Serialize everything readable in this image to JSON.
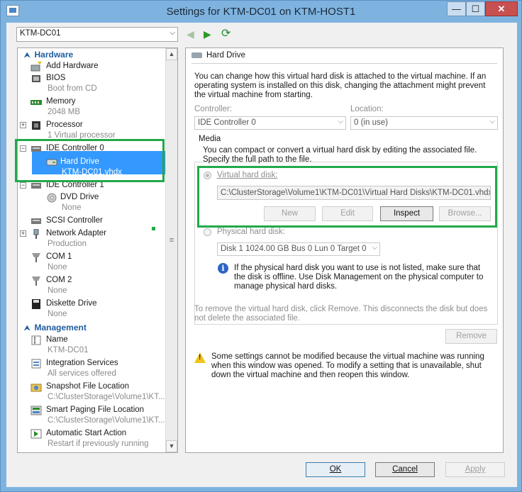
{
  "window": {
    "title": "Settings for KTM-DC01 on KTM-HOST1",
    "min_glyph": "—",
    "max_glyph": "☐",
    "close_glyph": "✕"
  },
  "vm_selector": {
    "value": "KTM-DC01",
    "arrow": "⌵"
  },
  "toolbar": {
    "back_glyph": "◀",
    "forward_glyph": "▶",
    "refresh_glyph": "⟳"
  },
  "tree": {
    "hardware_header": "Hardware",
    "management_header": "Management",
    "items": [
      {
        "label": "Add Hardware",
        "sub": ""
      },
      {
        "label": "BIOS",
        "sub": "Boot from CD"
      },
      {
        "label": "Memory",
        "sub": "2048 MB"
      },
      {
        "label": "Processor",
        "sub": "1 Virtual processor"
      },
      {
        "label": "IDE Controller 0",
        "sub": ""
      },
      {
        "label": "Hard Drive",
        "sub": "KTM-DC01.vhdx"
      },
      {
        "label": "IDE Controller 1",
        "sub": ""
      },
      {
        "label": "DVD Drive",
        "sub": "None"
      },
      {
        "label": "SCSI Controller",
        "sub": ""
      },
      {
        "label": "Network Adapter",
        "sub": "Production"
      },
      {
        "label": "COM 1",
        "sub": "None"
      },
      {
        "label": "COM 2",
        "sub": "None"
      },
      {
        "label": "Diskette Drive",
        "sub": "None"
      }
    ],
    "mgmt_items": [
      {
        "label": "Name",
        "sub": "KTM-DC01"
      },
      {
        "label": "Integration Services",
        "sub": "All services offered"
      },
      {
        "label": "Snapshot File Location",
        "sub": "C:\\ClusterStorage\\Volume1\\KT..."
      },
      {
        "label": "Smart Paging File Location",
        "sub": "C:\\ClusterStorage\\Volume1\\KT..."
      },
      {
        "label": "Automatic Start Action",
        "sub": "Restart if previously running"
      }
    ]
  },
  "pane": {
    "header": "Hard Drive",
    "intro": "You can change how this virtual hard disk is attached to the virtual machine. If an operating system is installed on this disk, changing the attachment might prevent the virtual machine from starting.",
    "controller_label": "Controller:",
    "controller_value": "IDE Controller 0",
    "location_label": "Location:",
    "location_value": "0 (in use)",
    "media_label": "Media",
    "media_desc": "You can compact or convert a virtual hard disk by editing the associated file. Specify the full path to the file.",
    "vhd_label": "Virtual hard disk:",
    "vhd_path": "C:\\ClusterStorage\\Volume1\\KTM-DC01\\Virtual Hard Disks\\KTM-DC01.vhdx",
    "btn_new": "New",
    "btn_edit": "Edit",
    "btn_inspect": "Inspect",
    "btn_browse": "Browse...",
    "phys_label": "Physical hard disk:",
    "phys_value": "Disk 1 1024.00 GB Bus 0 Lun 0 Target 0",
    "phys_info": "If the physical hard disk you want to use is not listed, make sure that the disk is offline. Use Disk Management on the physical computer to manage physical hard disks.",
    "remove_text": "To remove the virtual hard disk, click Remove. This disconnects the disk but does not delete the associated file.",
    "btn_remove": "Remove",
    "warning": "Some settings cannot be modified because the virtual machine was running when this window was opened. To modify a setting that is unavailable, shut down the virtual machine and then reopen this window."
  },
  "footer": {
    "ok": "OK",
    "cancel": "Cancel",
    "apply": "Apply"
  },
  "colors": {
    "highlight": "#22a94a",
    "selection": "#3399ff",
    "section": "#1f5da0"
  }
}
